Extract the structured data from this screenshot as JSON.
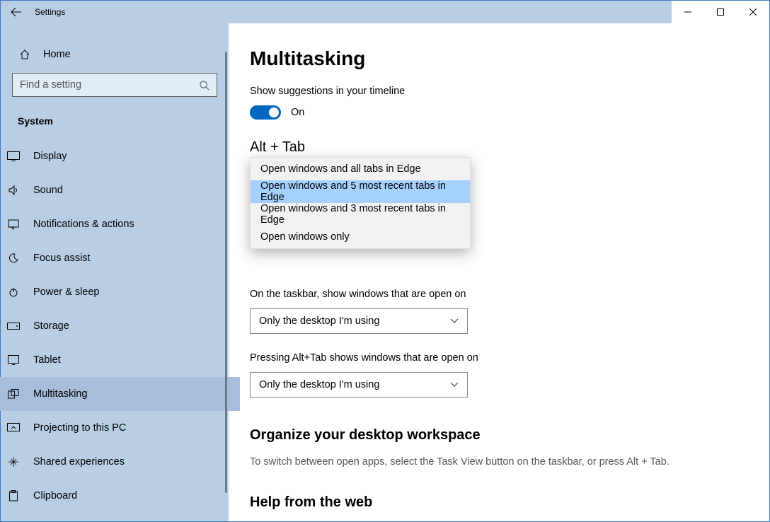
{
  "titlebar": {
    "title": "Settings"
  },
  "sidebar": {
    "home": "Home",
    "search_placeholder": "Find a setting",
    "section": "System",
    "items": [
      {
        "label": "Display"
      },
      {
        "label": "Sound"
      },
      {
        "label": "Notifications & actions"
      },
      {
        "label": "Focus assist"
      },
      {
        "label": "Power & sleep"
      },
      {
        "label": "Storage"
      },
      {
        "label": "Tablet"
      },
      {
        "label": "Multitasking"
      },
      {
        "label": "Projecting to this PC"
      },
      {
        "label": "Shared experiences"
      },
      {
        "label": "Clipboard"
      }
    ]
  },
  "main": {
    "title": "Multitasking",
    "timeline_label": "Show suggestions in your timeline",
    "toggle_text": "On",
    "alt_tab_heading": "Alt + Tab",
    "dropdown_options": [
      "Open windows and all tabs in Edge",
      "Open windows and 5 most recent tabs in Edge",
      "Open windows and 3 most recent tabs in Edge",
      "Open windows only"
    ],
    "taskbar_label": "On the taskbar, show windows that are open on",
    "taskbar_value": "Only the desktop I'm using",
    "alttab_label": "Pressing Alt+Tab shows windows that are open on",
    "alttab_value": "Only the desktop I'm using",
    "organize_heading": "Organize your desktop workspace",
    "organize_desc": "To switch between open apps, select the Task View button on the taskbar, or press Alt + Tab.",
    "help_heading": "Help from the web"
  }
}
